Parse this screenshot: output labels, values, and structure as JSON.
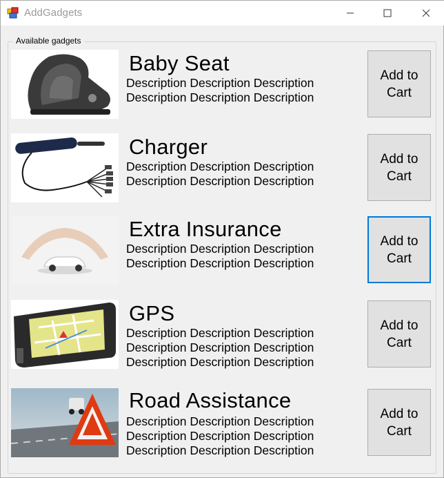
{
  "window": {
    "title": "AddGadgets"
  },
  "group": {
    "label": "Available gadgets"
  },
  "items": [
    {
      "name": "Baby Seat",
      "description_lines": [
        "Description Description Description",
        "Description Description Description"
      ],
      "button_label": "Add to\nCart"
    },
    {
      "name": "Charger",
      "description_lines": [
        "Description Description Description",
        "Description Description Description"
      ],
      "button_label": "Add to\nCart"
    },
    {
      "name": "Extra Insurance",
      "description_lines": [
        "Description Description Description",
        "Description Description Description"
      ],
      "button_label": "Add to\nCart"
    },
    {
      "name": "GPS",
      "description_lines": [
        "Description Description Description",
        "Description Description Description",
        "Description Description Description"
      ],
      "button_label": "Add to\nCart"
    },
    {
      "name": "Road Assistance",
      "description_lines": [
        "Description Description Description",
        "Description Description Description",
        "Description Description Description"
      ],
      "button_label": "Add to\nCart"
    }
  ],
  "colors": {
    "focus_border": "#0078d7",
    "button_face": "#e1e1e1",
    "window_bg": "#f0f0f0"
  }
}
